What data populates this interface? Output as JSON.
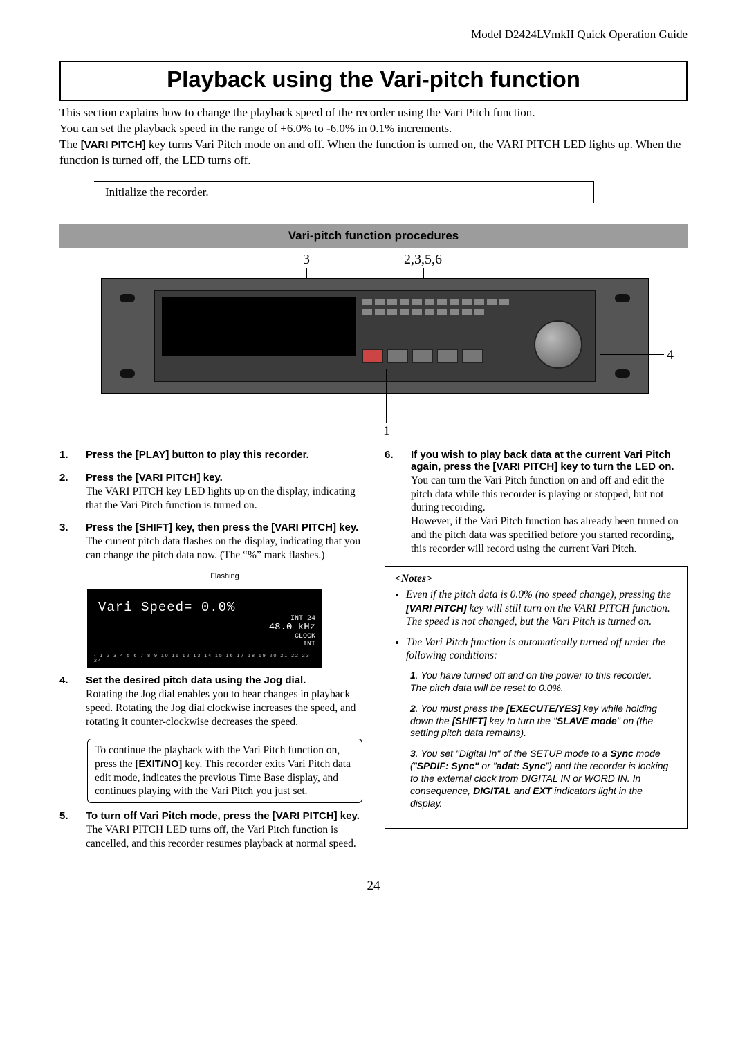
{
  "header": "Model D2424LVmkII  Quick Operation Guide",
  "title": "Playback using the Vari-pitch function",
  "intro": {
    "l1": "This section explains how to change the playback speed of the recorder using the Vari Pitch function.",
    "l2": "You can set the playback speed in the range of +6.0% to -6.0% in 0.1% increments.",
    "l3a": "The ",
    "l3key": "[VARI PITCH]",
    "l3b": " key turns Vari Pitch mode on and off. When the function is turned on, the VARI PITCH LED lights up.  When the function is turned off, the LED turns off."
  },
  "init": "Initialize the recorder.",
  "proc_header": "Vari-pitch function procedures",
  "callouts": {
    "topA": "3",
    "topB": "2,3,5,6",
    "right": "4",
    "bottom": "1"
  },
  "steps_left": [
    {
      "num": "1.",
      "head": "Press the [PLAY] button to play this recorder.",
      "text": ""
    },
    {
      "num": "2.",
      "head": "Press the [VARI PITCH] key.",
      "text": "The VARI PITCH key LED lights up on the display, indicating that the Vari Pitch function is turned on."
    },
    {
      "num": "3.",
      "head": "Press the [SHIFT] key, then press the [VARI PITCH] key.",
      "text": "The current pitch data flashes on the display, indicating that you can change the pitch data now. (The “%” mark flashes.)"
    },
    {
      "num": "4.",
      "head": "Set the desired pitch data using the Jog dial.",
      "text": "Rotating the Jog dial enables you to hear changes in playback speed.  Rotating the Jog dial clockwise increases the speed, and rotating it counter-clockwise decreases the speed."
    },
    {
      "num": "5.",
      "head": "To turn off Vari Pitch mode, press the [VARI PITCH] key.",
      "text": "The VARI PITCH LED turns off, the Vari Pitch function is cancelled, and this recorder resumes playback at normal speed."
    }
  ],
  "lcd": {
    "flash_label": "Flashing",
    "line": "Vari Speed= 0.0%",
    "side1": "INT    24",
    "side2": "48.0 kHz",
    "side3": "CLOCK",
    "side4": "INT",
    "ticks": "- 1 2 3 4 5 6 7 8 9 10 11 12 13 14 15 16 17 18 19 20 21 22 23 24"
  },
  "inset": {
    "a": "To continue the playback with the Vari Pitch function on, press the ",
    "key": "[EXIT/NO]",
    "b": " key.  This recorder exits Vari Pitch data edit mode, indicates the previous Time Base display, and continues playing with the Vari Pitch you just set."
  },
  "step6": {
    "num": "6.",
    "head": "If you wish to play back data at the current Vari Pitch again, press the [VARI PITCH] key to turn the LED on.",
    "t1": "You can turn the Vari Pitch function on and off and edit the pitch data while this recorder is playing or stopped, but not during recording.",
    "t2": "However, if the Vari Pitch function has already been turned on and the pitch data was specified before you started recording, this recorder will record using the current Vari Pitch."
  },
  "notes": {
    "title": "<Notes>",
    "b1a": "Even if the pitch data is 0.0% (no speed change), pressing the ",
    "b1key": "[VARI PITCH]",
    "b1b": " key will still turn on the VARI PITCH function. The speed is not changed, but the Vari Pitch is turned on.",
    "b2": "The Vari Pitch function is automatically turned off   under the following conditions:",
    "s1n": "1",
    "s1": ". You have turned off and on the power to this recorder.\nThe pitch data will be reset to 0.0%.",
    "s2n": "2",
    "s2a": ". You must press the ",
    "s2k1": "[EXECUTE/YES]",
    "s2b": " key while holding down the ",
    "s2k2": "[SHIFT]",
    "s2c": " key to turn the \"",
    "s2k3": "SLAVE mode",
    "s2d": "\" on (the setting pitch data remains).",
    "s3n": "3",
    "s3a": ". You set \"Digital In\" of the SETUP mode to a ",
    "s3k1": "Sync",
    "s3b": " mode (\"",
    "s3k2": "SPDIF: Sync\"",
    "s3c": " or \"",
    "s3k3": "adat: Sync",
    "s3d": "\") and the recorder  is locking to the external clock from DIGITAL IN or WORD IN.  In consequence, ",
    "s3k4": "DIGITAL",
    "s3e": "  and  ",
    "s3k5": "EXT",
    "s3f": "  indicators light in the display."
  },
  "page_number": "24"
}
